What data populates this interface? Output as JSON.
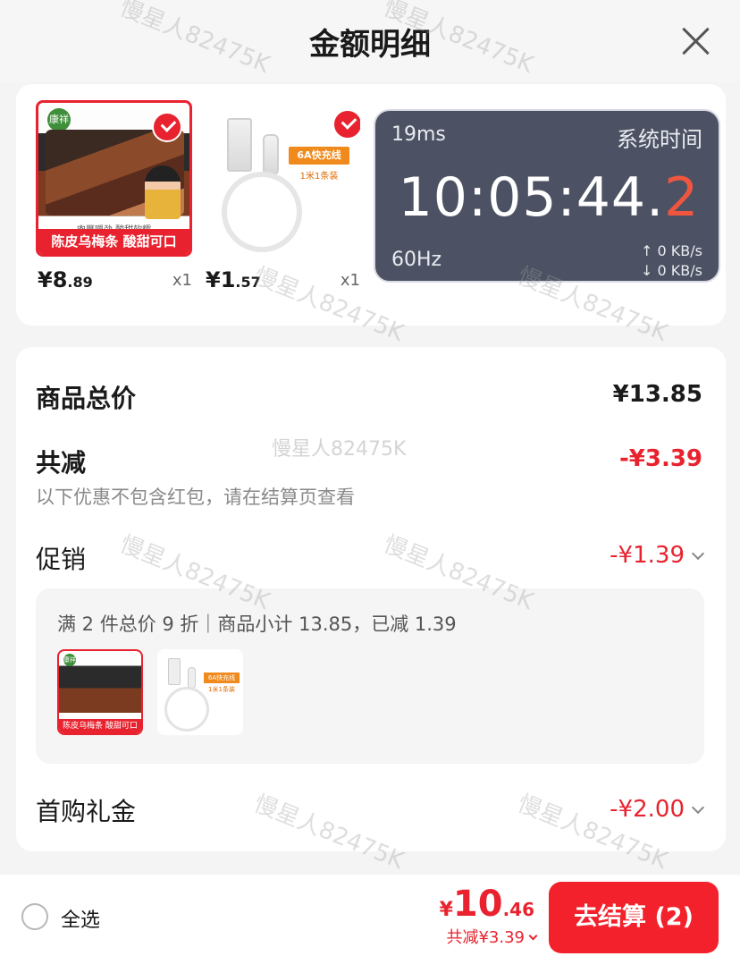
{
  "header": {
    "title": "金额明细"
  },
  "products": [
    {
      "thumb_caption": "陈皮乌梅条 酸甜可口",
      "thumb_sub": "肉厚嚼劲 酸甜软糯",
      "brand_logo": "康祥",
      "price_int": "¥8",
      "price_dec": ".89",
      "qty": "x1",
      "selected": true
    },
    {
      "tag": "6A快充线",
      "tag_sub": "1米1条装",
      "price_int": "¥1",
      "price_dec": ".57",
      "qty": "x1",
      "selected": true
    }
  ],
  "overlay": {
    "latency": "19ms",
    "label": "系统时间",
    "clock_main": "10:05:44.",
    "clock_last": "2",
    "refresh": "60Hz",
    "upload": "↑ 0 KB/s",
    "download": "↓ 0 KB/s"
  },
  "detail": {
    "total_label": "商品总价",
    "total_value": "¥13.85",
    "discount_label": "共减",
    "discount_value": "-¥3.39",
    "hint": "以下优惠不包含红包，请在结算页查看",
    "promo_label": "促销",
    "promo_value": "-¥1.39",
    "promo_desc": "满 2 件总价 9 折｜商品小计 13.85，已减 1.39",
    "mini1_caption": "陈皮乌梅条 酸甜可口",
    "mini2_tag": "6A快充线",
    "mini2_tag_sub": "1米1条装",
    "gift_label": "首购礼金",
    "gift_value": "-¥2.00"
  },
  "bottom": {
    "select_all": "全选",
    "total_yen": "¥",
    "total_int": "10",
    "total_dec": ".46",
    "saved": "共减¥3.39",
    "checkout": "去结算 (2)"
  },
  "watermark": "慢星人82475K",
  "colors": {
    "accent": "#e8232f",
    "overlay_bg": "#4c5263",
    "clock_highlight": "#f05540"
  }
}
